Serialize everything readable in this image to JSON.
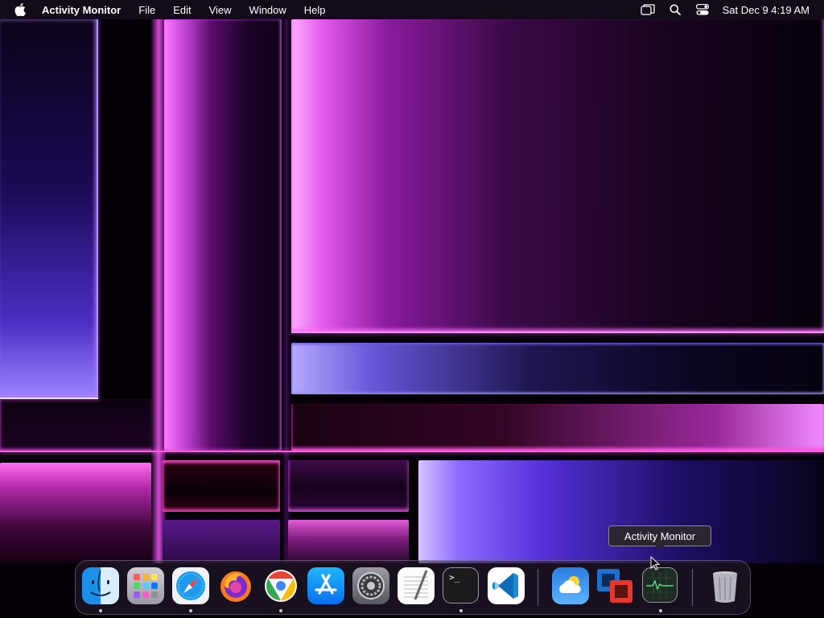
{
  "menubar": {
    "apple_icon": "apple-logo-icon",
    "app_name": "Activity Monitor",
    "items": [
      "File",
      "Edit",
      "View",
      "Window",
      "Help"
    ],
    "status_icons": [
      "screen-mirroring-icon",
      "spotlight-search-icon",
      "control-center-icon"
    ],
    "clock": "Sat Dec 9  4:19 AM"
  },
  "dock": {
    "items": [
      {
        "name": "Finder",
        "icon": "finder-icon",
        "running": true
      },
      {
        "name": "Launchpad",
        "icon": "launchpad-icon",
        "running": false
      },
      {
        "name": "Safari",
        "icon": "safari-icon",
        "running": true
      },
      {
        "name": "Firefox",
        "icon": "firefox-icon",
        "running": false
      },
      {
        "name": "Google Chrome",
        "icon": "chrome-icon",
        "running": true
      },
      {
        "name": "App Store",
        "icon": "app-store-icon",
        "running": false
      },
      {
        "name": "System Settings",
        "icon": "system-settings-icon",
        "running": false
      },
      {
        "name": "TextEdit",
        "icon": "textedit-icon",
        "running": false
      },
      {
        "name": "Terminal",
        "icon": "terminal-icon",
        "running": true
      },
      {
        "name": "Visual Studio Code",
        "icon": "vscode-icon",
        "running": false
      },
      {
        "name": "Weather",
        "icon": "weather-icon",
        "running": false
      },
      {
        "name": "VMware Fusion",
        "icon": "vmware-fusion-icon",
        "running": false
      },
      {
        "name": "Activity Monitor",
        "icon": "activity-monitor-icon",
        "running": true
      },
      {
        "name": "Trash",
        "icon": "trash-icon",
        "running": false
      }
    ],
    "terminal_prompt": ">_"
  },
  "tooltip": {
    "label": "Activity Monitor"
  },
  "colors": {
    "menubar_bg": "#140c1a",
    "tooltip_bg": "#2a2530",
    "accent_magenta": "#ff6bff",
    "accent_violet": "#8d6bff"
  }
}
